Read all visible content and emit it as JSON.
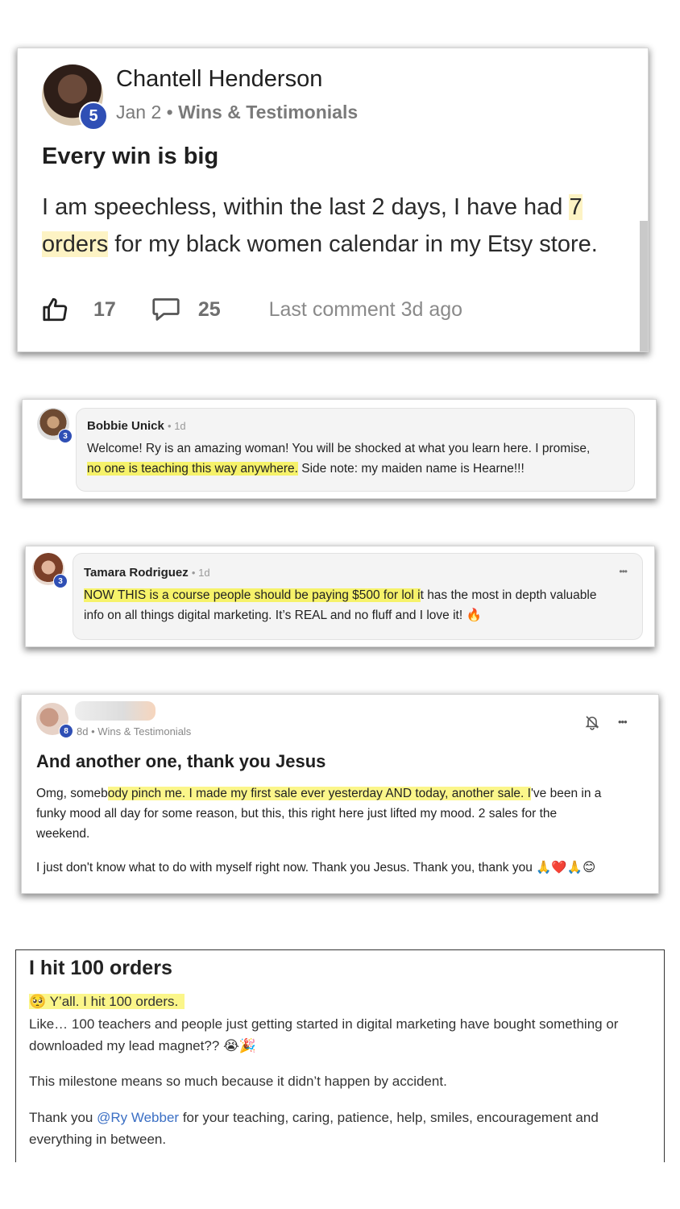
{
  "post1": {
    "author": "Chantell Henderson",
    "level": "5",
    "date": "Jan 2",
    "separator": "•",
    "category": "Wins & Testimonials",
    "title": "Every win is big",
    "body_pre": "I am speechless, within the last 2 days, I have had ",
    "body_hl": "7 orders",
    "body_hl_a": "7",
    "body_hl_b": "orders",
    "body_post": " for my black women calendar in my Etsy store.",
    "likes": "17",
    "comments": "25",
    "last_comment": "Last comment 3d ago",
    "icons": {
      "like": "thumbs-up-icon",
      "comment": "comment-bubble-icon"
    }
  },
  "comment1": {
    "author": "Bobbie Unick",
    "time": "• 1d",
    "level": "3",
    "text_a": "Welcome! Ry is an amazing woman! You will be shocked at what you learn here. I promise,",
    "text_hl": "no one is teaching this way anywhere.",
    "text_b": " Side note: my maiden name is Hearne!!!"
  },
  "comment2": {
    "author": "Tamara Rodriguez",
    "time": "• 1d",
    "level": "3",
    "more": "•••",
    "text_hl": "NOW THIS is a course people should be paying $500 for lol i",
    "text_a": "t has the most in depth valuable",
    "text_b": "info on all things digital marketing. It’s REAL and no fluff and I love it! 🔥"
  },
  "post2": {
    "level": "8",
    "meta": "8d • Wins & Testimonials",
    "more": "•••",
    "title": "And another one, thank you Jesus",
    "line1_a": "Omg, someb",
    "line1_hl": "ody pinch me. I made my first sale ever yesterday AND today, another sale. I",
    "line1_b": "'ve been in a",
    "line2": "funky mood all day for some reason, but this, this right here just lifted my mood. 2 sales for the",
    "line3": "weekend.",
    "line4": "I just don't know what to do with myself right now. Thank you Jesus. Thank you, thank you 🙏❤️🙏😊",
    "icons": {
      "bell": "bell-off-icon"
    }
  },
  "post3": {
    "title": "I hit 100 orders",
    "hl_line": "🥺 Y’all. I hit 100 orders.",
    "para1": "Like… 100 teachers and people just getting started in digital marketing have bought something or downloaded my lead magnet?? 😭🎉",
    "para2": "This milestone means so much because it didn’t happen by accident.",
    "thanks_a": "Thank you ",
    "mention": "@Ry Webber",
    "thanks_b": " for your teaching, caring, patience, help, smiles, encouragement and everything in between."
  },
  "colors": {
    "badge": "#2f4fb5",
    "highlight": "#f6f26a",
    "mention": "#3b6fc4"
  }
}
